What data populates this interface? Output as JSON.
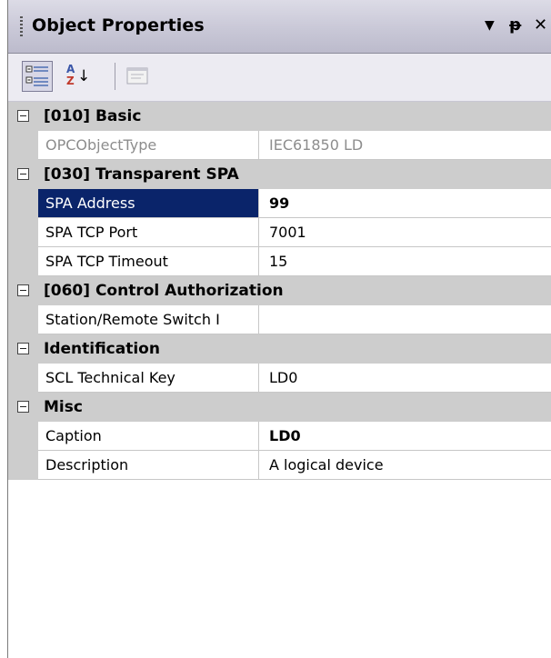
{
  "window": {
    "title": "Object Properties",
    "buttons": {
      "dropdown": "▼",
      "pin": "ᵽ",
      "close": "✕"
    }
  },
  "toolbar": {
    "buttons": [
      {
        "name": "categorized-button",
        "icon": "categorized-icon",
        "active": true
      },
      {
        "name": "alphabetical-button",
        "icon": "sort-az-icon",
        "active": false
      },
      {
        "name": "property-pages-button",
        "icon": "property-pages-icon",
        "active": false
      }
    ],
    "alpha_top": "A",
    "alpha_bottom": "Z",
    "alpha_arrow": "↓"
  },
  "colors": {
    "category_bg": "#cdcdcd",
    "selected_bg": "#0a246a",
    "readonly_text": "#8d8d8d"
  },
  "grid": {
    "categories": [
      {
        "label": "[010] Basic",
        "properties": [
          {
            "name": "OPCObjectType",
            "value": "IEC61850 LD",
            "readonly": true
          }
        ]
      },
      {
        "label": "[030] Transparent SPA",
        "properties": [
          {
            "name": "SPA Address",
            "value": "99",
            "selected": true,
            "bold": true
          },
          {
            "name": "SPA TCP Port",
            "value": "7001"
          },
          {
            "name": "SPA TCP Timeout",
            "value": "15"
          }
        ]
      },
      {
        "label": "[060] Control Authorization",
        "properties": [
          {
            "name": "Station/Remote Switch I",
            "value": ""
          }
        ]
      },
      {
        "label": "Identification",
        "properties": [
          {
            "name": "SCL Technical Key",
            "value": "LD0"
          }
        ]
      },
      {
        "label": "Misc",
        "properties": [
          {
            "name": "Caption",
            "value": "LD0",
            "bold": true
          },
          {
            "name": "Description",
            "value": "A logical device"
          }
        ]
      }
    ]
  }
}
